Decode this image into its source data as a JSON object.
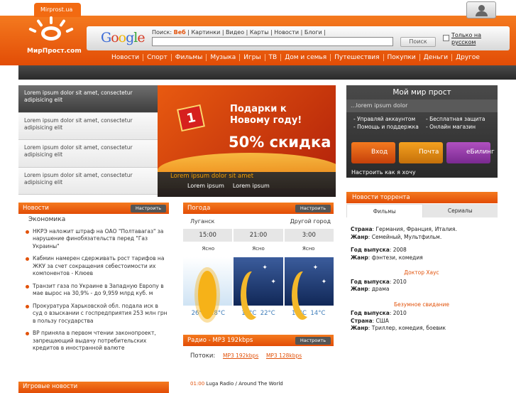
{
  "header": {
    "site_tab": "Mirprost.ua",
    "logo_text": "МирПрост.com",
    "search": {
      "label": "Поиск:",
      "active_link": "Веб",
      "links": "| Картинки | Видео | Карты | Новости | Блоги |",
      "value": "",
      "button": "Поиск",
      "only_russian": "Только на русском"
    },
    "nav": [
      "Новости",
      "Спорт",
      "Фильмы",
      "Музыка",
      "Игры",
      "ТВ",
      "Дом и семья",
      "Путешествия",
      "Покупки",
      "Деньги",
      "Другое"
    ]
  },
  "promo_list": [
    "Lorem ipsum dolor sit amet, consectetur adipisicing elit",
    "Lorem ipsum dolor sit amet, consectetur adipisicing elit",
    "Lorem ipsum dolor sit amet, consectetur adipisicing elit",
    "Lorem ipsum dolor sit amet, consectetur adipisicing elit"
  ],
  "banner": {
    "headline": "Подарки к Новому году!",
    "discount": "50% скидка",
    "caption": "Lorem ipsum dolor sit amet",
    "bullets": [
      "Lorem ipsum",
      "Lorem ipsum"
    ],
    "gift_number": "1"
  },
  "my_world": {
    "title": "Мой мир прост",
    "subtitle": "...lorem ipsum dolor",
    "links": [
      "- Управляй аккаунтом",
      "- Бесплатная защита",
      "- Помощь и поддержка",
      "- Онлайн магазин"
    ],
    "buttons": [
      "Вход",
      "Почта",
      "eБилинг"
    ],
    "settings_link": "Настроить как я хочу"
  },
  "torrent": {
    "title": "Новости торрента",
    "tabs": [
      "Фильмы",
      "Сериалы"
    ],
    "entries": [
      {
        "rows": [
          [
            "Страна",
            "Германия, Франция, Италия."
          ],
          [
            "Жанр",
            "Семейный, Мультфильм."
          ]
        ]
      },
      {
        "rows": [
          [
            "Год выпуска",
            "2008"
          ],
          [
            "Жанр",
            "фэнтези, комедия"
          ]
        ]
      },
      {
        "movie": "Доктор Хаус",
        "rows": [
          [
            "Год выпуска",
            "2010"
          ],
          [
            "Жанр",
            "драма"
          ]
        ]
      },
      {
        "movie": "Безумное свидание",
        "rows": [
          [
            "Год выпуска",
            "2010"
          ],
          [
            "Страна",
            "США"
          ],
          [
            "Жанр",
            "Триллер, комедия, боевик"
          ]
        ]
      }
    ]
  },
  "news": {
    "title": "Новости",
    "configure": "Настроить",
    "category": "Экономика",
    "items": [
      "НКРЭ наложит штраф на ОАО \"Полтавагаз\" за нарушение финобязательств перед \"Газ Украины\"",
      "Кабмин намерен сдерживать рост тарифов на ЖКУ за счет сокращения себестоимости их компонентов - Клюев",
      "Транзит газа по Украине в Западную Европу в мае вырос на 30,9% - до 9,959 млрд куб. м",
      "Прокуратура Харьковской обл. подала иск в суд о взыскании с госпредприятия 253 млн грн в пользу государства",
      "ВР приняла в первом чтении законопроект, запрещающий выдачу потребительских кредитов в иностранной валюте"
    ],
    "next_section": "Игровые новости"
  },
  "weather": {
    "title": "Погода",
    "configure": "Настроить",
    "city": "Луганск",
    "other_city": "Другой город",
    "times": [
      "15:00",
      "21:00",
      "3:00"
    ],
    "conditions": [
      "Ясно",
      "Ясно",
      "Ясно"
    ],
    "temps": [
      [
        "26°C",
        "28°C"
      ],
      [
        "18°C",
        "22°C"
      ],
      [
        "11°C",
        "14°C"
      ]
    ]
  },
  "radio": {
    "title": "Радио - MP3 192kbps",
    "configure": "Настроить",
    "streams_label": "Потоки:",
    "streams": [
      "MP3 192kbps",
      "MP3 128kbps"
    ],
    "now_time": "01:00",
    "now_station": "Luga Radio / Around The World"
  }
}
